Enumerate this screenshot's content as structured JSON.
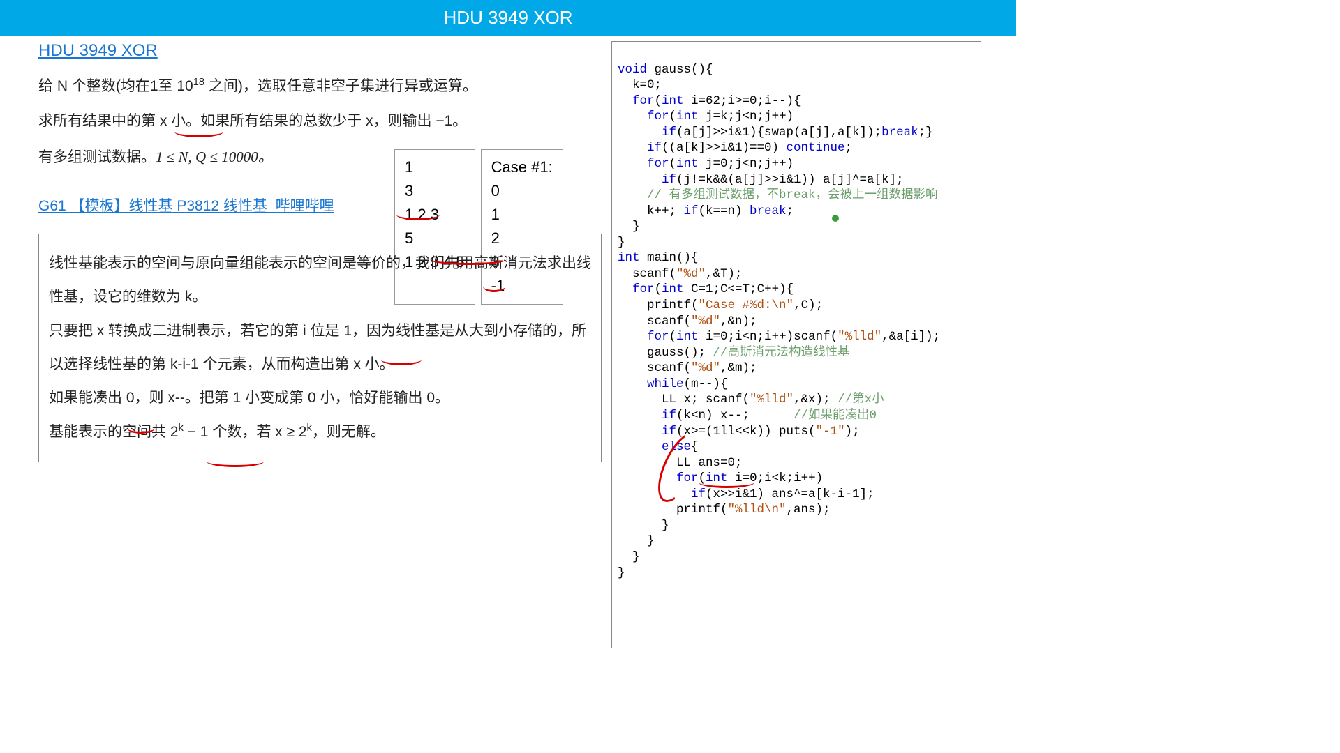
{
  "header": {
    "title": "HDU 3949 XOR"
  },
  "title_link": "HDU 3949 XOR",
  "problem": {
    "line1_pre": "给 N 个整数(均在1至 ",
    "line1_pow": "10",
    "line1_exp": "18",
    "line1_post": " 之间)，选取任意非空子集进行异或运算。",
    "line2": "求所有结果中的第 x 小。如果所有结果的总数少于 x，则输出 −1。",
    "line3_pre": "有多组测试数据。",
    "line3_math": "1 ≤ N, Q ≤ 10000。"
  },
  "ref_link": "G61 【模板】线性基 P3812 线性基_哔哩哔哩",
  "io": {
    "in": "1\n3\n1 2 3\n5\n1 2 3 4 5",
    "out": "Case #1:\n0\n1\n2\n3\n-1"
  },
  "explain": {
    "p1": "线性基能表示的空间与原向量组能表示的空间是等价的，我们先用高斯消元法求出线性基，设它的维数为 k。",
    "p2": "只要把 x 转换成二进制表示，若它的第 i 位是 1，因为线性基是从大到小存储的，所以选择线性基的第 k-i-1 个元素，从而构造出第 x 小。",
    "p3": "如果能凑出 0，则 x--。把第 1 小变成第 0 小，恰好能输出 0。",
    "p4_pre": "基能表示的空间共 ",
    "p4_a": "2",
    "p4_aexp": "k",
    "p4_mid": " − 1 个数，若 x ≥ ",
    "p4_b": "2",
    "p4_bexp": "k",
    "p4_post": "，则无解。"
  },
  "code": {
    "l1a": "void",
    "l1b": " gauss(){",
    "l2": "  k=0;",
    "l3a": "  for",
    "l3b": "(",
    "l3c": "int",
    "l3d": " i=62;i>=0;i--){",
    "l4a": "    for",
    "l4b": "(",
    "l4c": "int",
    "l4d": " j=k;j<n;j++)",
    "l5a": "      if",
    "l5b": "(a[j]>>i&1){swap(a[j],a[k]);",
    "l5c": "break",
    "l5d": ";}",
    "l6a": "    if",
    "l6b": "((a[k]>>i&1)==0) ",
    "l6c": "continue",
    "l6d": ";",
    "l7a": "    for",
    "l7b": "(",
    "l7c": "int",
    "l7d": " j=0;j<n;j++)",
    "l8a": "      if",
    "l8b": "(j!=k&&(a[j]>>i&1)) a[j]^=a[k];",
    "l9": "    // 有多组测试数据，不break，会被上一组数据影响",
    "l10a": "    k++; ",
    "l10b": "if",
    "l10c": "(k==n) ",
    "l10d": "break",
    "l10e": ";",
    "l11": "  }",
    "l12": "}",
    "l13a": "int",
    "l13b": " main(){",
    "l14a": "  scanf(",
    "l14b": "\"%d\"",
    "l14c": ",&T);",
    "l15a": "  for",
    "l15b": "(",
    "l15c": "int",
    "l15d": " C=1;C<=T;C++){",
    "l16a": "    printf(",
    "l16b": "\"Case #%d:\\n\"",
    "l16c": ",C);",
    "l17a": "    scanf(",
    "l17b": "\"%d\"",
    "l17c": ",&n);",
    "l18a": "    for",
    "l18b": "(",
    "l18c": "int",
    "l18d": " i=0;i<n;i++)scanf(",
    "l18e": "\"%lld\"",
    "l18f": ",&a[i]);",
    "l19a": "    gauss(); ",
    "l19b": "//高斯消元法构造线性基",
    "l20a": "    scanf(",
    "l20b": "\"%d\"",
    "l20c": ",&m);",
    "l21a": "    while",
    "l21b": "(m--){",
    "l22a": "      LL x; scanf(",
    "l22b": "\"%lld\"",
    "l22c": ",&x); ",
    "l22d": "//第x小",
    "l23a": "      if",
    "l23b": "(k<n) x--;      ",
    "l23c": "//如果能凑出0",
    "l24a": "      if",
    "l24b": "(x>=(1ll<<k)) puts(",
    "l24c": "\"-1\"",
    "l24d": ");",
    "l25a": "      else",
    "l25b": "{",
    "l26": "        LL ans=0;",
    "l27a": "        for",
    "l27b": "(",
    "l27c": "int",
    "l27d": " i=0;i<k;i++)",
    "l28a": "          if",
    "l28b": "(x>>i&1) ans^=a[k-i-1];",
    "l29a": "        printf(",
    "l29b": "\"%lld\\n\"",
    "l29c": ",ans);",
    "l30": "      }",
    "l31": "    }",
    "l32": "  }",
    "l33": "}"
  }
}
